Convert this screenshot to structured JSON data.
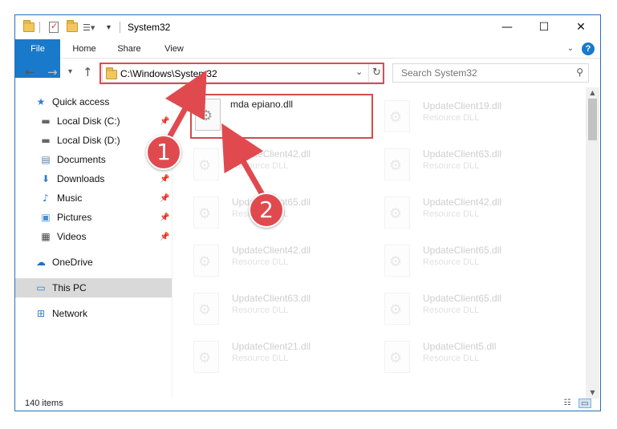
{
  "window": {
    "title": "System32",
    "ribbon_tabs": [
      "File",
      "Home",
      "Share",
      "View"
    ],
    "controls": {
      "minimize": "—",
      "maximize": "☐",
      "close": "✕"
    }
  },
  "address_bar": {
    "path": "C:\\Windows\\System32"
  },
  "search": {
    "placeholder": "Search System32"
  },
  "nav_pane": {
    "items": [
      {
        "label": "Quick access",
        "icon": "star-icon",
        "pinned": false
      },
      {
        "label": "Local Disk (C:)",
        "icon": "drive-icon",
        "pinned": true
      },
      {
        "label": "Local Disk (D:)",
        "icon": "drive-icon",
        "pinned": false
      },
      {
        "label": "Documents",
        "icon": "documents-icon",
        "pinned": true
      },
      {
        "label": "Downloads",
        "icon": "download-icon",
        "pinned": true
      },
      {
        "label": "Music",
        "icon": "music-icon",
        "pinned": true
      },
      {
        "label": "Pictures",
        "icon": "pictures-icon",
        "pinned": true
      },
      {
        "label": "Videos",
        "icon": "videos-icon",
        "pinned": true
      },
      {
        "label": "OneDrive",
        "icon": "cloud-icon",
        "pinned": false
      },
      {
        "label": "This PC",
        "icon": "computer-icon",
        "pinned": false,
        "selected": true
      },
      {
        "label": "Network",
        "icon": "network-icon",
        "pinned": false
      }
    ]
  },
  "files": {
    "highlighted": {
      "name": "mda epiano.dll"
    },
    "left_column": [
      {
        "name": "UpdateClient42.dll",
        "type": "Resource DLL"
      },
      {
        "name": "UpdateClient65.dll",
        "type": "Resource DLL"
      },
      {
        "name": "UpdateClient42.dll",
        "type": "Resource DLL"
      },
      {
        "name": "UpdateClient63.dll",
        "type": "Resource DLL"
      },
      {
        "name": "UpdateClient21.dll",
        "type": "Resource DLL"
      }
    ],
    "right_column": [
      {
        "name": "UpdateClient19.dll",
        "type": "Resource DLL"
      },
      {
        "name": "UpdateClient63.dll",
        "type": "Resource DLL"
      },
      {
        "name": "UpdateClient42.dll",
        "type": "Resource DLL"
      },
      {
        "name": "UpdateClient65.dll",
        "type": "Resource DLL"
      },
      {
        "name": "UpdateClient65.dll",
        "type": "Resource DLL"
      },
      {
        "name": "UpdateClient5.dll",
        "type": "Resource DLL"
      }
    ]
  },
  "status_bar": {
    "item_count": "140 items"
  },
  "annotations": {
    "step1": "1",
    "step2": "2",
    "color": "#e04a4f"
  }
}
